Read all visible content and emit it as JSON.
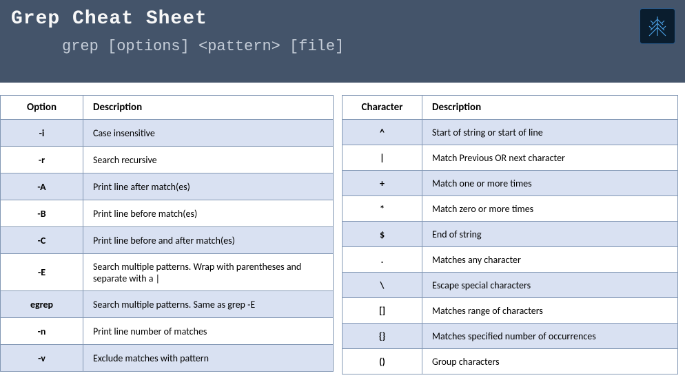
{
  "header": {
    "title": "Grep Cheat Sheet",
    "usage": "grep [options] <pattern> [file]"
  },
  "options_table": {
    "header_option": "Option",
    "header_description": "Description",
    "rows": [
      {
        "option": "-i",
        "description": "Case insensitive"
      },
      {
        "option": "-r",
        "description": "Search recursive"
      },
      {
        "option": "-A",
        "description": "Print line after match(es)"
      },
      {
        "option": "-B",
        "description": "Print line before match(es)"
      },
      {
        "option": "-C",
        "description": "Print line before and after match(es)"
      },
      {
        "option": "-E",
        "description": "Search multiple patterns. Wrap with parentheses and separate with a |"
      },
      {
        "option": "egrep",
        "description": "Search multiple patterns. Same as grep -E"
      },
      {
        "option": "-n",
        "description": "Print line number of matches"
      },
      {
        "option": "-v",
        "description": "Exclude matches with pattern"
      }
    ]
  },
  "characters_table": {
    "header_character": "Character",
    "header_description": "Description",
    "rows": [
      {
        "character": "^",
        "description": "Start of string or start of line"
      },
      {
        "character": "|",
        "description": "Match Previous OR next character"
      },
      {
        "character": "+",
        "description": "Match one or more times"
      },
      {
        "character": "*",
        "description": "Match zero or more times"
      },
      {
        "character": "$",
        "description": "End of string"
      },
      {
        "character": ".",
        "description": "Matches any character"
      },
      {
        "character": "\\",
        "description": "Escape special characters"
      },
      {
        "character": "[]",
        "description": "Matches range of characters"
      },
      {
        "character": "{}",
        "description": "Matches specified number of occurrences"
      },
      {
        "character": "()",
        "description": "Group characters"
      }
    ]
  }
}
